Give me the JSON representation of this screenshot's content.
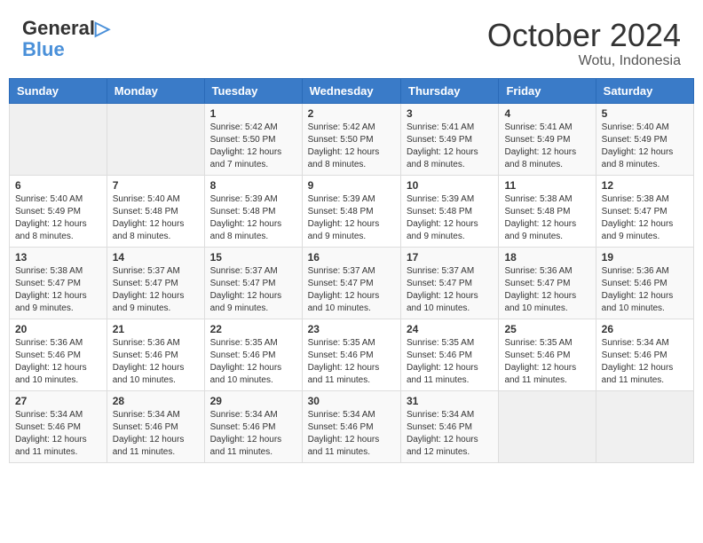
{
  "header": {
    "logo_general": "General",
    "logo_blue": "Blue",
    "month_title": "October 2024",
    "location": "Wotu, Indonesia"
  },
  "weekdays": [
    "Sunday",
    "Monday",
    "Tuesday",
    "Wednesday",
    "Thursday",
    "Friday",
    "Saturday"
  ],
  "weeks": [
    [
      {
        "day": "",
        "info": ""
      },
      {
        "day": "",
        "info": ""
      },
      {
        "day": "1",
        "info": "Sunrise: 5:42 AM\nSunset: 5:50 PM\nDaylight: 12 hours and 7 minutes."
      },
      {
        "day": "2",
        "info": "Sunrise: 5:42 AM\nSunset: 5:50 PM\nDaylight: 12 hours and 8 minutes."
      },
      {
        "day": "3",
        "info": "Sunrise: 5:41 AM\nSunset: 5:49 PM\nDaylight: 12 hours and 8 minutes."
      },
      {
        "day": "4",
        "info": "Sunrise: 5:41 AM\nSunset: 5:49 PM\nDaylight: 12 hours and 8 minutes."
      },
      {
        "day": "5",
        "info": "Sunrise: 5:40 AM\nSunset: 5:49 PM\nDaylight: 12 hours and 8 minutes."
      }
    ],
    [
      {
        "day": "6",
        "info": "Sunrise: 5:40 AM\nSunset: 5:49 PM\nDaylight: 12 hours and 8 minutes."
      },
      {
        "day": "7",
        "info": "Sunrise: 5:40 AM\nSunset: 5:48 PM\nDaylight: 12 hours and 8 minutes."
      },
      {
        "day": "8",
        "info": "Sunrise: 5:39 AM\nSunset: 5:48 PM\nDaylight: 12 hours and 8 minutes."
      },
      {
        "day": "9",
        "info": "Sunrise: 5:39 AM\nSunset: 5:48 PM\nDaylight: 12 hours and 9 minutes."
      },
      {
        "day": "10",
        "info": "Sunrise: 5:39 AM\nSunset: 5:48 PM\nDaylight: 12 hours and 9 minutes."
      },
      {
        "day": "11",
        "info": "Sunrise: 5:38 AM\nSunset: 5:48 PM\nDaylight: 12 hours and 9 minutes."
      },
      {
        "day": "12",
        "info": "Sunrise: 5:38 AM\nSunset: 5:47 PM\nDaylight: 12 hours and 9 minutes."
      }
    ],
    [
      {
        "day": "13",
        "info": "Sunrise: 5:38 AM\nSunset: 5:47 PM\nDaylight: 12 hours and 9 minutes."
      },
      {
        "day": "14",
        "info": "Sunrise: 5:37 AM\nSunset: 5:47 PM\nDaylight: 12 hours and 9 minutes."
      },
      {
        "day": "15",
        "info": "Sunrise: 5:37 AM\nSunset: 5:47 PM\nDaylight: 12 hours and 9 minutes."
      },
      {
        "day": "16",
        "info": "Sunrise: 5:37 AM\nSunset: 5:47 PM\nDaylight: 12 hours and 10 minutes."
      },
      {
        "day": "17",
        "info": "Sunrise: 5:37 AM\nSunset: 5:47 PM\nDaylight: 12 hours and 10 minutes."
      },
      {
        "day": "18",
        "info": "Sunrise: 5:36 AM\nSunset: 5:47 PM\nDaylight: 12 hours and 10 minutes."
      },
      {
        "day": "19",
        "info": "Sunrise: 5:36 AM\nSunset: 5:46 PM\nDaylight: 12 hours and 10 minutes."
      }
    ],
    [
      {
        "day": "20",
        "info": "Sunrise: 5:36 AM\nSunset: 5:46 PM\nDaylight: 12 hours and 10 minutes."
      },
      {
        "day": "21",
        "info": "Sunrise: 5:36 AM\nSunset: 5:46 PM\nDaylight: 12 hours and 10 minutes."
      },
      {
        "day": "22",
        "info": "Sunrise: 5:35 AM\nSunset: 5:46 PM\nDaylight: 12 hours and 10 minutes."
      },
      {
        "day": "23",
        "info": "Sunrise: 5:35 AM\nSunset: 5:46 PM\nDaylight: 12 hours and 11 minutes."
      },
      {
        "day": "24",
        "info": "Sunrise: 5:35 AM\nSunset: 5:46 PM\nDaylight: 12 hours and 11 minutes."
      },
      {
        "day": "25",
        "info": "Sunrise: 5:35 AM\nSunset: 5:46 PM\nDaylight: 12 hours and 11 minutes."
      },
      {
        "day": "26",
        "info": "Sunrise: 5:34 AM\nSunset: 5:46 PM\nDaylight: 12 hours and 11 minutes."
      }
    ],
    [
      {
        "day": "27",
        "info": "Sunrise: 5:34 AM\nSunset: 5:46 PM\nDaylight: 12 hours and 11 minutes."
      },
      {
        "day": "28",
        "info": "Sunrise: 5:34 AM\nSunset: 5:46 PM\nDaylight: 12 hours and 11 minutes."
      },
      {
        "day": "29",
        "info": "Sunrise: 5:34 AM\nSunset: 5:46 PM\nDaylight: 12 hours and 11 minutes."
      },
      {
        "day": "30",
        "info": "Sunrise: 5:34 AM\nSunset: 5:46 PM\nDaylight: 12 hours and 11 minutes."
      },
      {
        "day": "31",
        "info": "Sunrise: 5:34 AM\nSunset: 5:46 PM\nDaylight: 12 hours and 12 minutes."
      },
      {
        "day": "",
        "info": ""
      },
      {
        "day": "",
        "info": ""
      }
    ]
  ]
}
